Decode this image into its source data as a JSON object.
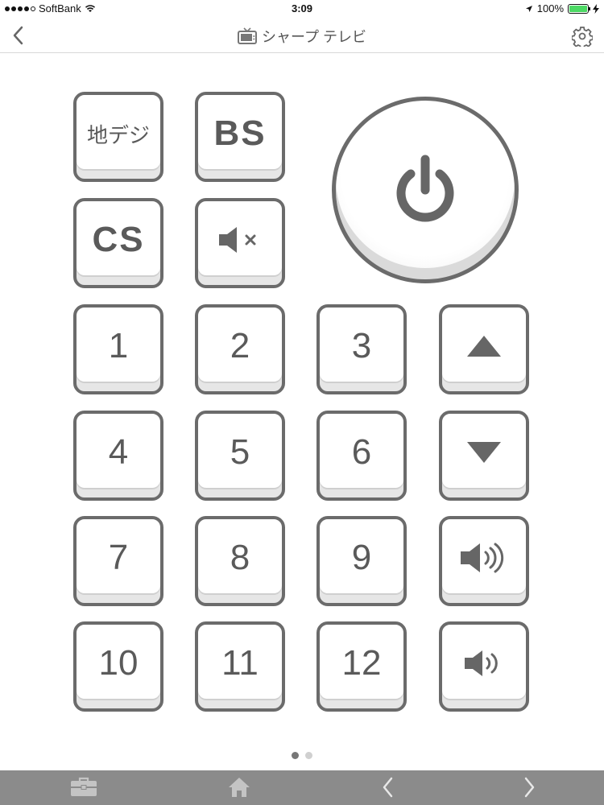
{
  "status_bar": {
    "carrier": "SoftBank",
    "time": "3:09",
    "battery": "100%",
    "battery_level": 1.0
  },
  "nav": {
    "title": "シャープ テレビ",
    "back_icon": "chevron-left-icon",
    "title_icon": "tv-icon",
    "settings_icon": "gear-icon"
  },
  "buttons": {
    "terrestrial": "地デジ",
    "bs": "BS",
    "cs": "CS",
    "mute_icon": "mute-icon",
    "power_icon": "power-icon",
    "numbers": [
      "1",
      "2",
      "3",
      "4",
      "5",
      "6",
      "7",
      "8",
      "9",
      "10",
      "11",
      "12"
    ],
    "channel_up_icon": "triangle-up-icon",
    "channel_down_icon": "triangle-down-icon",
    "volume_up_icon": "volume-up-icon",
    "volume_down_icon": "volume-down-icon"
  },
  "pagination": {
    "pages": 2,
    "current": 1
  },
  "toolbar": {
    "items": [
      "toolbox-icon",
      "home-icon",
      "chevron-left-icon",
      "chevron-right-icon"
    ]
  },
  "colors": {
    "button_border": "#6b6b6b",
    "toolbar_bg": "#8b8b8b",
    "battery": "#4cd964"
  }
}
